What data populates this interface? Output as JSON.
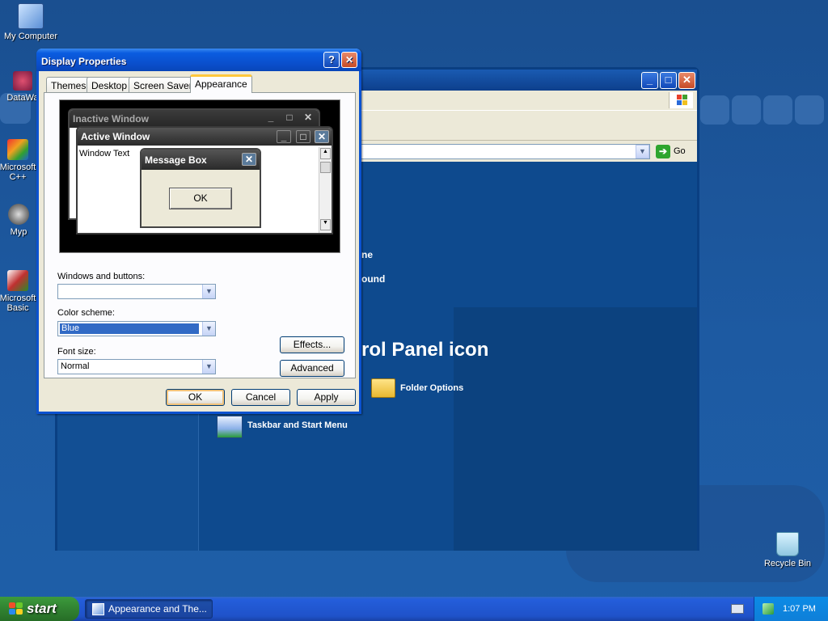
{
  "desktop": {
    "icons": [
      {
        "label": "My Computer"
      },
      {
        "label": "DataWa"
      },
      {
        "label": "Microsoft C++"
      },
      {
        "label": "Myp"
      },
      {
        "label": "Microsoft Basic"
      },
      {
        "label": "Recycle Bin"
      }
    ]
  },
  "control_panel": {
    "address_go": "Go",
    "heading": "rol Panel icon",
    "items": [
      {
        "label": "ne"
      },
      {
        "label": "ound"
      },
      {
        "label": "Folder Options"
      },
      {
        "label": "Taskbar and Start Menu"
      }
    ]
  },
  "dialog": {
    "title": "Display Properties",
    "help_glyph": "?",
    "close_glyph": "✕",
    "tabs": [
      {
        "label": "Themes"
      },
      {
        "label": "Desktop"
      },
      {
        "label": "Screen Saver"
      },
      {
        "label": "Appearance"
      }
    ],
    "preview": {
      "inactive_title": "Inactive Window",
      "active_title": "Active Window",
      "window_text": "Window Text",
      "message_title": "Message Box",
      "message_ok": "OK"
    },
    "windows_buttons_label": "Windows and buttons:",
    "windows_buttons_value": "",
    "color_scheme_label": "Color scheme:",
    "color_scheme_value": "Blue",
    "font_size_label": "Font size:",
    "font_size_value": "Normal",
    "effects_button": "Effects...",
    "advanced_button": "Advanced",
    "ok_button": "OK",
    "cancel_button": "Cancel",
    "apply_button": "Apply"
  },
  "taskbar": {
    "start_label": "start",
    "task_item": "Appearance and The...",
    "clock": "1:07 PM"
  }
}
